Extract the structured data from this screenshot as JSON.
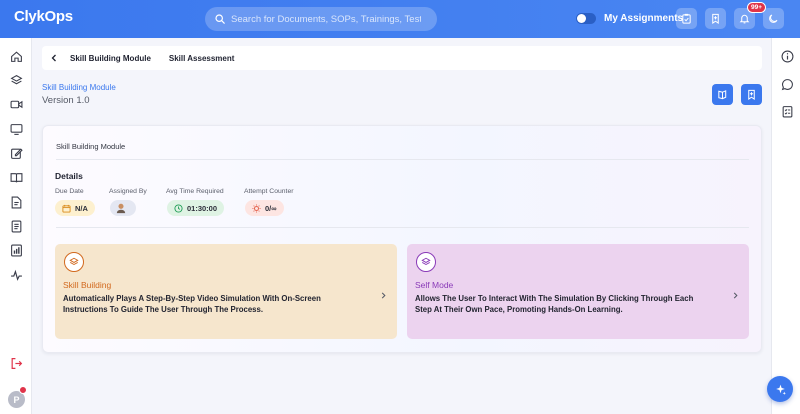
{
  "app": {
    "logo_text": "ClykOps"
  },
  "search": {
    "placeholder": "Search for Documents, SOPs, Trainings, Tests"
  },
  "topbar": {
    "my_assignments_label": "My Assignments",
    "notification_count": "99+"
  },
  "user": {
    "avatar_initial": "P"
  },
  "tabs": [
    {
      "label": "Skill Building Module"
    },
    {
      "label": "Skill Assessment"
    }
  ],
  "header": {
    "module_link": "Skill Building Module",
    "version": "Version 1.0"
  },
  "card": {
    "title": "Skill Building Module",
    "details_heading": "Details",
    "meta": {
      "due_date": {
        "label": "Due Date",
        "value": "N/A"
      },
      "assigned_by": {
        "label": "Assigned By"
      },
      "avg_time": {
        "label": "Avg Time Required",
        "value": "01:30:00"
      },
      "attempt_counter": {
        "label": "Attempt Counter",
        "value": "0/∞"
      }
    },
    "modes": [
      {
        "title": "Skill Building",
        "description": "Automatically Plays A Step-By-Step Video Simulation With On-Screen Instructions To Guide The User Through The Process."
      },
      {
        "title": "Self Mode",
        "description": "Allows The User To Interact With The Simulation By Clicking Through Each Step At Their Own Pace, Promoting Hands-On Learning."
      }
    ]
  },
  "colors": {
    "accent": "#3b78ee",
    "skill_building_bg": "#f6e6cd",
    "skill_building_title": "#d2691e",
    "self_mode_bg": "#ecd3ef",
    "self_mode_title": "#8a3bb8"
  }
}
